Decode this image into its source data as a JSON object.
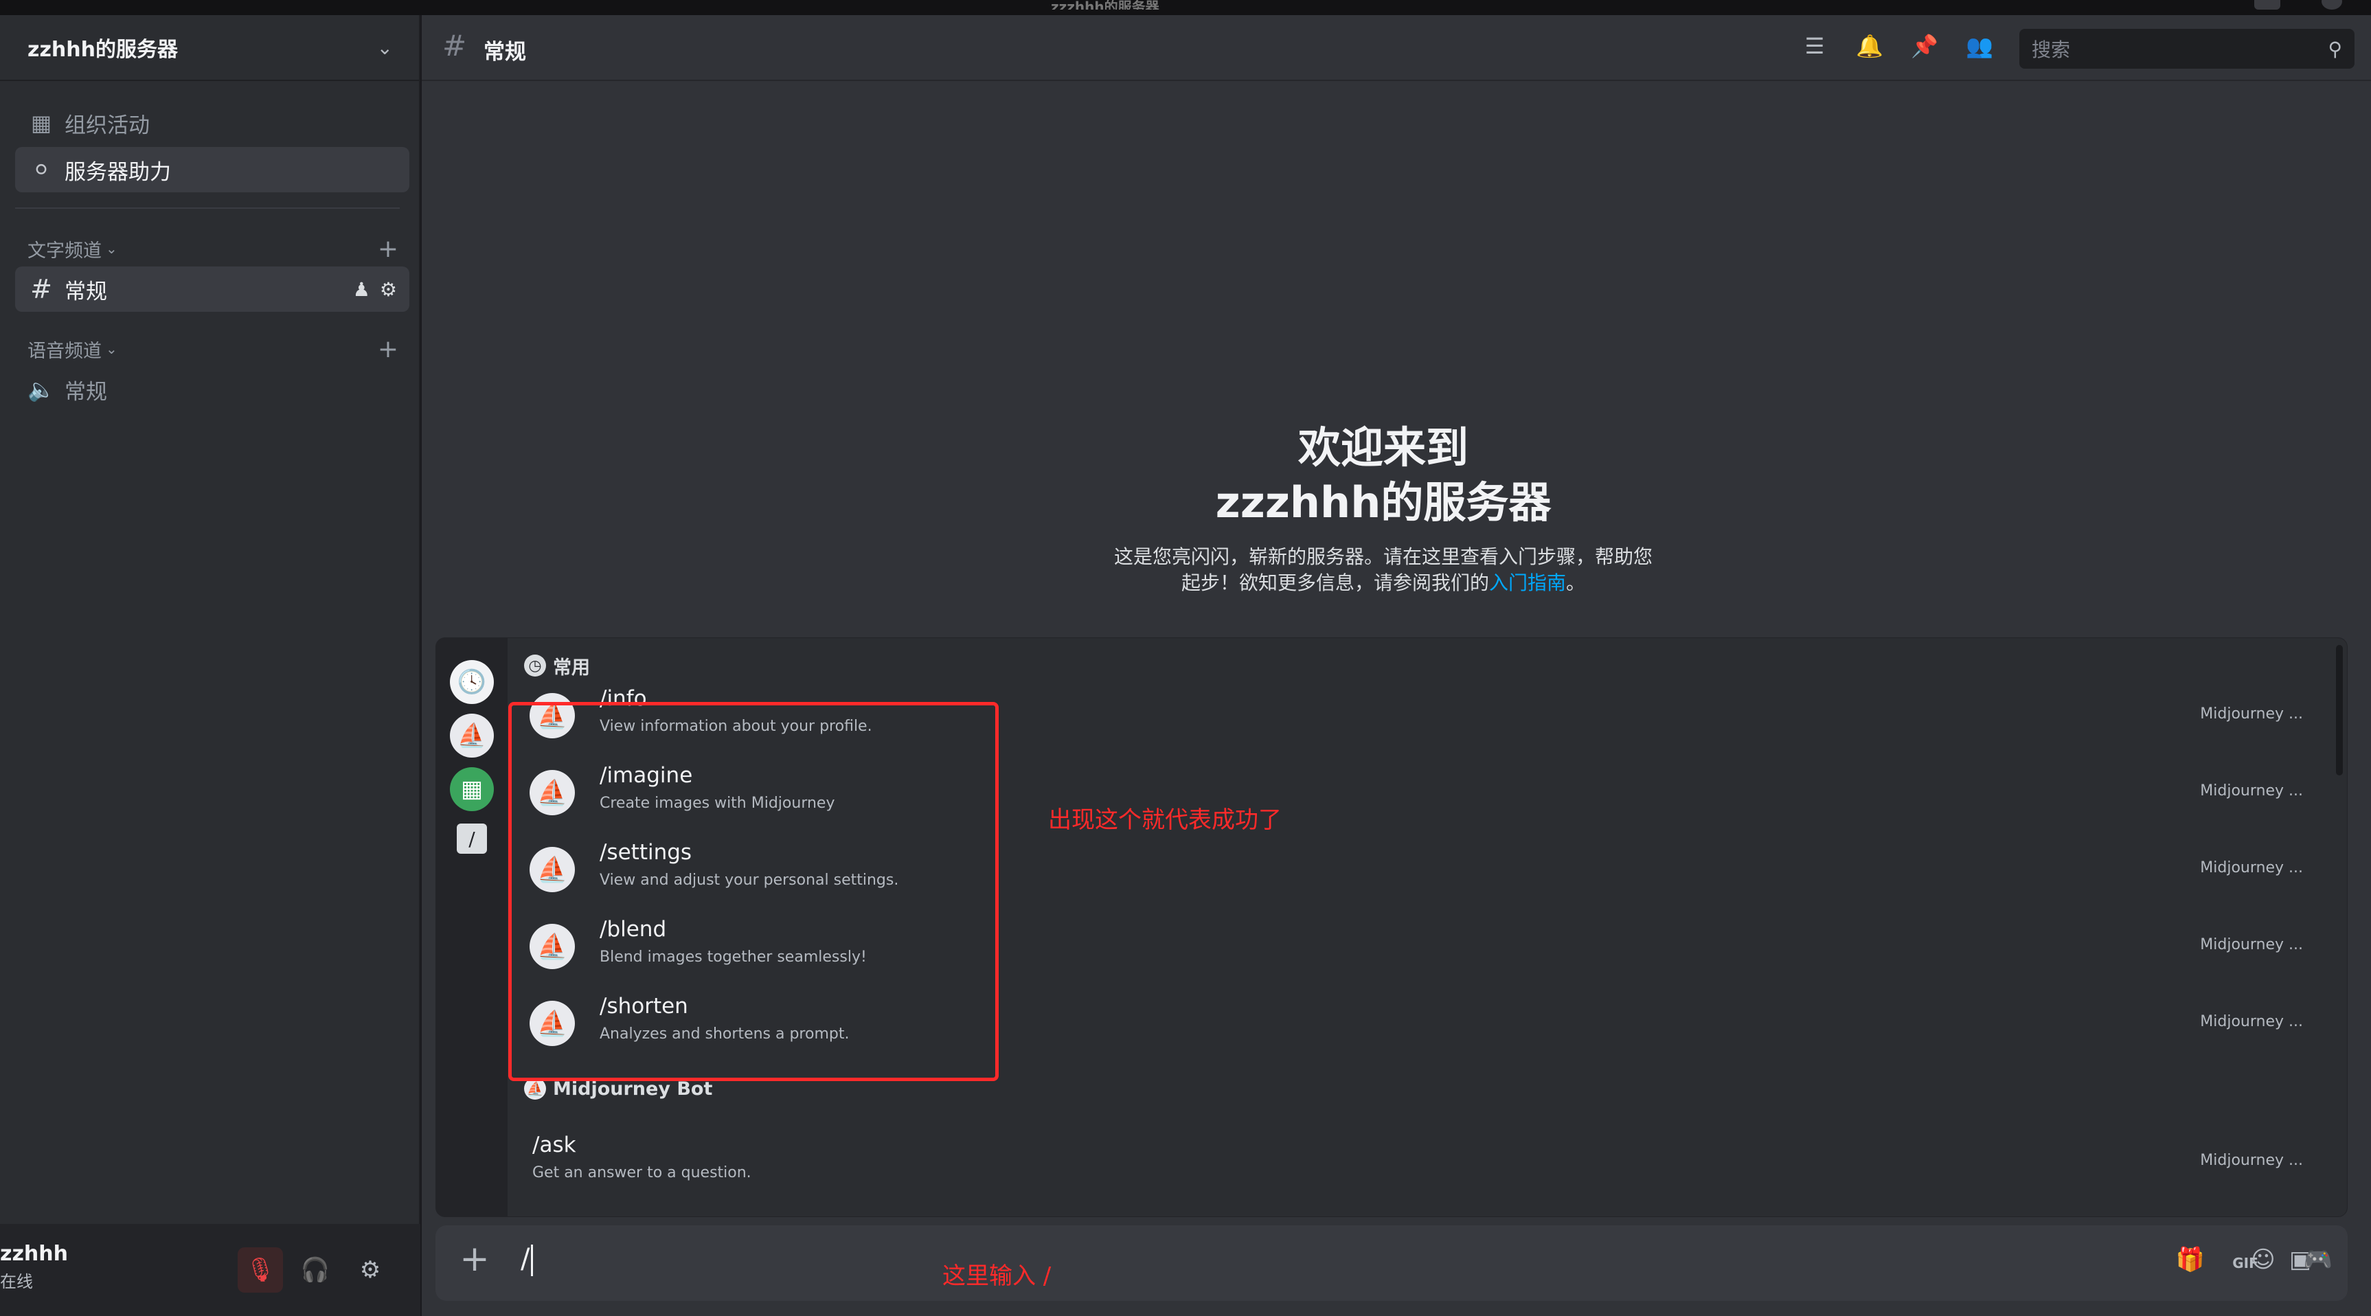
{
  "window": {
    "title": "zzzhhh的服务器"
  },
  "server": {
    "name": "zzhhh的服务器"
  },
  "sidebar": {
    "top_items": [
      {
        "label": "组织活动",
        "icon": "calendar-icon"
      },
      {
        "label": "服务器助力",
        "icon": "boost-icon"
      }
    ],
    "text_category": "文字频道",
    "text_channels": [
      {
        "label": "常规"
      }
    ],
    "voice_category": "语音频道",
    "voice_channels": [
      {
        "label": "常规"
      }
    ]
  },
  "user": {
    "name": "zzhhh",
    "status": "在线"
  },
  "header": {
    "channel": "常规",
    "search_placeholder": "搜索"
  },
  "welcome": {
    "line1": "欢迎来到",
    "line2": "zzzhhh的服务器",
    "desc1": "这是您亮闪闪，崭新的服务器。请在这里查看入门步骤，帮助您",
    "desc2": "起步！欲知更多信息，请参阅我们的",
    "link": "入门指南",
    "desc2_end": "。"
  },
  "popup": {
    "section_frequent": "常用",
    "commands": [
      {
        "name": "/info",
        "desc": "View information about your profile.",
        "source": "Midjourney ..."
      },
      {
        "name": "/imagine",
        "desc": "Create images with Midjourney",
        "source": "Midjourney ..."
      },
      {
        "name": "/settings",
        "desc": "View and adjust your personal settings.",
        "source": "Midjourney ..."
      },
      {
        "name": "/blend",
        "desc": "Blend images together seamlessly!",
        "source": "Midjourney ..."
      },
      {
        "name": "/shorten",
        "desc": "Analyzes and shortens a prompt.",
        "source": "Midjourney ..."
      }
    ],
    "section_bot": "Midjourney Bot",
    "bot_commands": [
      {
        "name": "/ask",
        "desc": "Get an answer to a question.",
        "source": "Midjourney ..."
      }
    ]
  },
  "annotations": {
    "success": "出现这个就代表成功了",
    "input_hint": "这里输入 /"
  },
  "input": {
    "value": "/"
  }
}
